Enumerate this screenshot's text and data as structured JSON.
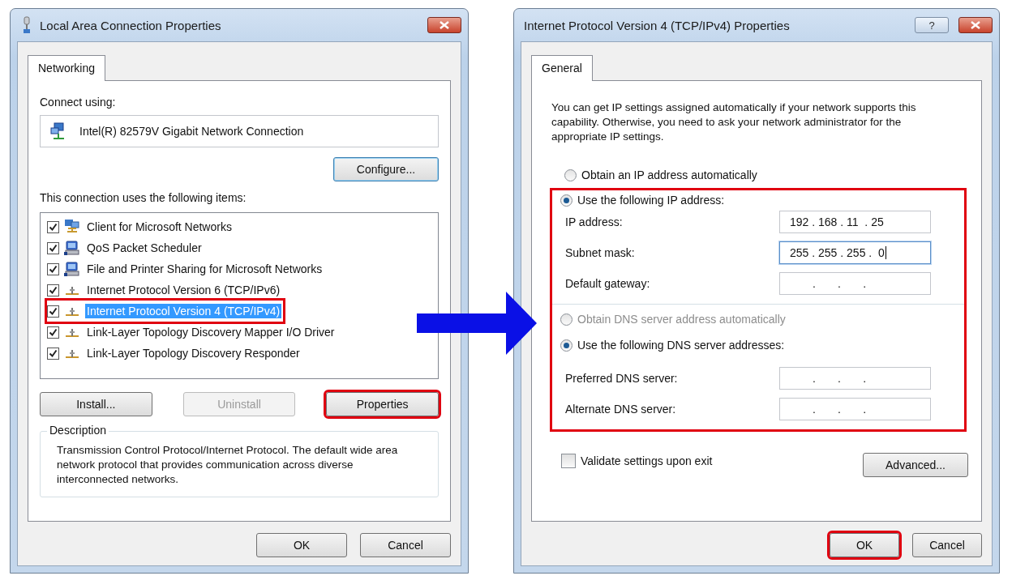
{
  "left_dialog": {
    "title": "Local Area Connection Properties",
    "tabs": [
      {
        "label": "Networking",
        "selected": true
      }
    ],
    "connect_label": "Connect using:",
    "adapter": "Intel(R) 82579V Gigabit Network Connection",
    "configure_button": "Configure...",
    "items_label": "This connection uses the following items:",
    "items": [
      {
        "label": "Client for Microsoft Networks",
        "kind": "client",
        "checked": true,
        "selected": false,
        "highlighted": false
      },
      {
        "label": "QoS Packet Scheduler",
        "kind": "service",
        "checked": true,
        "selected": false,
        "highlighted": false
      },
      {
        "label": "File and Printer Sharing for Microsoft Networks",
        "kind": "service",
        "checked": true,
        "selected": false,
        "highlighted": false
      },
      {
        "label": "Internet Protocol Version 6 (TCP/IPv6)",
        "kind": "protocol",
        "checked": true,
        "selected": false,
        "highlighted": false
      },
      {
        "label": "Internet Protocol Version 4 (TCP/IPv4)",
        "kind": "protocol",
        "checked": true,
        "selected": true,
        "highlighted": true
      },
      {
        "label": "Link-Layer Topology Discovery Mapper I/O Driver",
        "kind": "protocol",
        "checked": true,
        "selected": false,
        "highlighted": false
      },
      {
        "label": "Link-Layer Topology Discovery Responder",
        "kind": "protocol",
        "checked": true,
        "selected": false,
        "highlighted": false
      }
    ],
    "buttons": [
      {
        "label": "Install...",
        "disabled": false,
        "highlighted": false
      },
      {
        "label": "Uninstall",
        "disabled": true,
        "highlighted": false
      },
      {
        "label": "Properties",
        "disabled": false,
        "highlighted": true
      }
    ],
    "description": {
      "legend": "Description",
      "text": "Transmission Control Protocol/Internet Protocol. The default wide area network protocol that provides communication across diverse interconnected networks."
    },
    "footer_buttons": [
      {
        "label": "OK",
        "highlighted": false
      },
      {
        "label": "Cancel",
        "highlighted": false
      }
    ]
  },
  "right_dialog": {
    "title": "Internet Protocol Version 4 (TCP/IPv4) Properties",
    "help_button": "?",
    "tabs": [
      {
        "label": "General",
        "selected": true
      }
    ],
    "intro": "You can get IP settings assigned automatically if your network supports this capability. Otherwise, you need to ask your network administrator for the appropriate IP settings.",
    "ip_auto": {
      "label": "Obtain an IP address automatically",
      "selected": false,
      "disabled": false
    },
    "highlighted": true,
    "ip_static": {
      "label": "Use the following IP address:",
      "selected": true,
      "disabled": false
    },
    "ip_fields": [
      {
        "label": "IP address:",
        "value": "192 . 168 . 11  . 25",
        "focused": false
      },
      {
        "label": "Subnet mask:",
        "value": "255 . 255 . 255 .  0",
        "focused": true
      },
      {
        "label": "Default gateway:",
        "value": ".       .       .",
        "focused": false
      }
    ],
    "dns_auto": {
      "label": "Obtain DNS server address automatically",
      "selected": false,
      "disabled": true
    },
    "dns_static": {
      "label": "Use the following DNS server addresses:",
      "selected": true,
      "disabled": false
    },
    "dns_fields": [
      {
        "label": "Preferred DNS server:",
        "value": ".       .       .",
        "focused": false
      },
      {
        "label": "Alternate DNS server:",
        "value": ".       .       .",
        "focused": false
      }
    ],
    "validate": {
      "label": "Validate settings upon exit",
      "checked": false
    },
    "advanced_button": "Advanced...",
    "footer_buttons": [
      {
        "label": "OK",
        "highlighted": true
      },
      {
        "label": "Cancel",
        "highlighted": false
      }
    ]
  }
}
